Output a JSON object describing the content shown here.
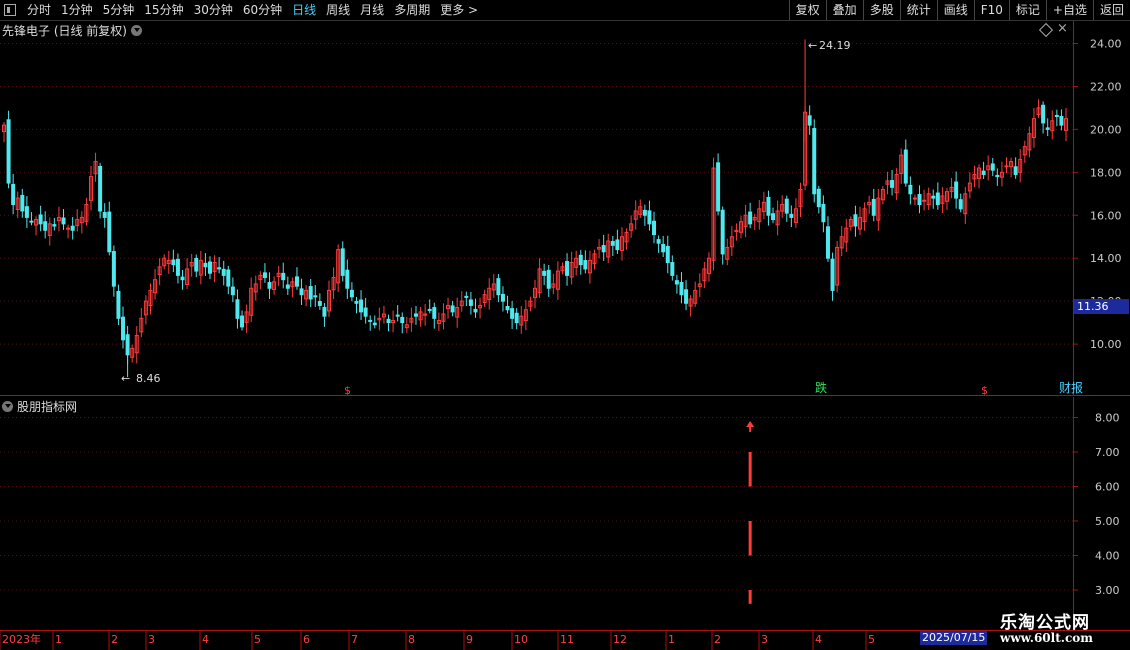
{
  "toolbar": {
    "periods": [
      "分时",
      "1分钟",
      "5分钟",
      "15分钟",
      "30分钟",
      "60分钟",
      "日线",
      "周线",
      "月线",
      "多周期",
      "更多 >"
    ],
    "active_period": "日线",
    "buttons": [
      "复权",
      "叠加",
      "多股",
      "统计",
      "画线",
      "F10",
      "标记",
      "+自选",
      "返回"
    ]
  },
  "stock": {
    "title": "先锋电子 (日线 前复权)",
    "current_price": "11.36"
  },
  "indicator": {
    "title": "股朋指标网"
  },
  "markers": {
    "high": "24.19",
    "low": "8.46",
    "s1": "$",
    "s2": "$",
    "die": "跌",
    "cai": "财报"
  },
  "axis": {
    "price_ticks": [
      "24.00",
      "22.00",
      "20.00",
      "18.00",
      "16.00",
      "14.00",
      "12.00",
      "10.00"
    ],
    "ind_ticks": [
      "8.00",
      "7.00",
      "6.00",
      "5.00",
      "4.00",
      "3.00"
    ],
    "time_labels": [
      "2023年",
      "1",
      "2",
      "3",
      "4",
      "5",
      "6",
      "7",
      "8",
      "9",
      "10",
      "11",
      "12",
      "1",
      "2",
      "3",
      "4",
      "5"
    ],
    "date_tag": "2025/07/15"
  },
  "watermark": {
    "line1": "乐淘公式网",
    "line2": "www.60lt.com"
  },
  "colors": {
    "up": "#ff3b3b",
    "down": "#4ee8ee",
    "grid_red": "#aa1111",
    "active": "#4ad0ff"
  },
  "chart_data": {
    "type": "candlestick",
    "y_range": [
      7.5,
      25
    ],
    "closes": [
      20.2,
      17.5,
      16.5,
      16.8,
      16.2,
      15.9,
      15.7,
      15.8,
      15.6,
      15.3,
      15.6,
      15.5,
      15.9,
      15.6,
      15.4,
      15.3,
      15.8,
      15.9,
      16.5,
      17.8,
      18.5,
      16.2,
      15.9,
      14.3,
      12.7,
      11.2,
      10.2,
      9.5,
      9.8,
      10.4,
      11.2,
      12.0,
      12.5,
      13.0,
      13.6,
      14.0,
      13.9,
      13.7,
      13.2,
      13.0,
      13.5,
      13.8,
      13.4,
      13.9,
      13.6,
      13.3,
      13.8,
      13.5,
      13.2,
      12.7,
      12.3,
      11.2,
      10.8,
      11.5,
      12.6,
      12.8,
      13.2,
      13.1,
      12.6,
      12.9,
      13.3,
      13.0,
      12.6,
      12.9,
      12.7,
      12.3,
      12.5,
      12.1,
      12.2,
      11.8,
      11.3,
      12.5,
      13.1,
      14.4,
      13.2,
      12.6,
      12.2,
      11.9,
      11.5,
      11.3,
      11.1,
      10.9,
      11.2,
      11.4,
      11.0,
      11.1,
      11.3,
      11.0,
      10.9,
      11.2,
      11.3,
      11.5,
      11.4,
      11.6,
      11.2,
      11.1,
      11.4,
      11.8,
      11.5,
      11.7,
      12.0,
      12.2,
      11.8,
      11.5,
      11.8,
      12.3,
      12.6,
      12.8,
      12.3,
      12.0,
      11.6,
      11.2,
      11.0,
      11.3,
      11.6,
      12.0,
      12.6,
      13.5,
      13.2,
      12.6,
      12.8,
      13.4,
      13.6,
      13.2,
      13.8,
      14.0,
      13.7,
      13.5,
      13.9,
      14.2,
      14.5,
      14.3,
      14.8,
      14.6,
      14.4,
      15.0,
      15.2,
      15.6,
      16.2,
      16.4,
      16.0,
      15.6,
      15.1,
      14.7,
      14.3,
      13.8,
      13.2,
      12.8,
      12.3,
      11.9,
      12.1,
      12.5,
      12.8,
      13.5,
      14.0,
      18.2,
      16.2,
      14.2,
      14.5,
      15.0,
      15.3,
      15.7,
      16.0,
      15.6,
      15.9,
      16.3,
      16.6,
      16.0,
      15.8,
      16.2,
      16.5,
      16.1,
      15.9,
      16.3,
      17.2,
      20.8,
      20.2,
      17.0,
      16.4,
      15.7,
      14.0,
      12.5,
      14.5,
      15.0,
      15.4,
      15.8,
      15.5,
      15.9,
      16.3,
      16.6,
      16.0,
      16.8,
      17.2,
      17.6,
      17.3,
      17.9,
      18.8,
      17.5,
      17.0,
      16.8,
      16.5,
      16.7,
      17.0,
      16.8,
      16.5,
      16.9,
      17.1,
      17.3,
      16.8,
      16.3,
      17.0,
      17.5,
      17.9,
      18.2,
      17.9,
      18.3,
      18.1,
      17.8,
      18.0,
      18.3,
      18.5,
      17.9,
      18.6,
      19.2,
      19.8,
      20.5,
      21.0,
      20.3,
      20.0,
      20.4,
      20.6,
      20.2,
      20.5
    ],
    "high_value": 24.19,
    "low_value": 8.46,
    "indicator": {
      "type": "bar",
      "x_index": 163,
      "range": [
        2.6,
        8.5
      ],
      "segments": [
        [
          2.6,
          3.0
        ],
        [
          4.0,
          5.0
        ],
        [
          6.0,
          7.0
        ]
      ],
      "arrow_value": 7.9
    }
  }
}
